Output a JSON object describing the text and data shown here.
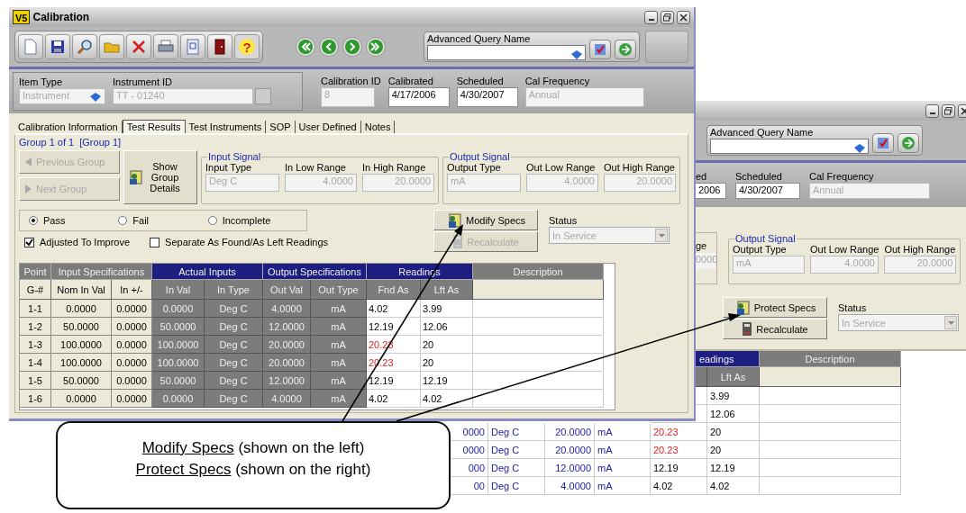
{
  "left_window": {
    "logo": "V5",
    "title": "Calibration",
    "help_glyph": "?",
    "query": {
      "label": "Advanced Query Name"
    },
    "header_fields": [
      {
        "kind": "combo",
        "label": "Item Type",
        "value": "Instrument",
        "disabled": true
      },
      {
        "kind": "lookup",
        "label": "Instrument ID",
        "value": "TT - 01240",
        "disabled": true
      },
      {
        "kind": "text",
        "label": "Calibration ID",
        "value": "8",
        "disabled": true
      },
      {
        "kind": "text",
        "label": "Calibrated",
        "value": "4/17/2006",
        "disabled": false
      },
      {
        "kind": "text",
        "label": "Scheduled",
        "value": "4/30/2007",
        "disabled": false
      },
      {
        "kind": "text",
        "label": "Cal Frequency",
        "value": "Annual",
        "disabled": true
      }
    ],
    "tabs": [
      {
        "label": "Calibration Information",
        "selected": false
      },
      {
        "label": "Test Results",
        "selected": true
      },
      {
        "label": "Test Instruments",
        "selected": false
      },
      {
        "label": "SOP",
        "selected": false
      },
      {
        "label": "User Defined",
        "selected": false
      },
      {
        "label": "Notes",
        "selected": false
      }
    ],
    "group_title": "Group 1 of 1  [Group 1]",
    "nav_buttons": [
      {
        "kind": "previous",
        "label": "Previous Group",
        "disabled": true
      },
      {
        "kind": "next",
        "label": "Next Group",
        "disabled": true
      }
    ],
    "details_button": {
      "label": "Show Group Details"
    },
    "signals": [
      {
        "title": "Input Signal",
        "fields": [
          {
            "kind": "type",
            "label": "Input Type",
            "value": "Deg C"
          },
          {
            "kind": "number",
            "label": "In Low Range",
            "value": "4.0000"
          },
          {
            "kind": "number",
            "label": "In High Range",
            "value": "20.0000"
          }
        ]
      },
      {
        "title": "Output Signal",
        "fields": [
          {
            "kind": "type",
            "label": "Output Type",
            "value": "mA"
          },
          {
            "kind": "number",
            "label": "Out Low Range",
            "value": "4.0000"
          },
          {
            "kind": "number",
            "label": "Out High Range",
            "value": "20.0000"
          }
        ]
      }
    ],
    "result_options": [
      {
        "label": "Pass",
        "selected": true
      },
      {
        "label": "Fail",
        "selected": false
      },
      {
        "label": "Incomplete",
        "selected": false
      }
    ],
    "checkboxes": [
      {
        "label": "Adjusted To Improve",
        "checked": true
      },
      {
        "label": "Separate As Found/As Left Readings",
        "checked": false
      }
    ],
    "spec_button": {
      "label": "Modify Specs",
      "disabled": false
    },
    "recalculate_button": {
      "label": "Recalculate",
      "disabled": true
    },
    "status": {
      "label": "Status",
      "value": "In Service",
      "disabled": true
    },
    "table": {
      "groups": [
        {
          "label": "Point",
          "kind": "spec",
          "columns": [
            "G-#"
          ]
        },
        {
          "label": "Input Specifications",
          "kind": "spec",
          "columns": [
            "Nom In Val",
            "In +/-"
          ]
        },
        {
          "label": "Actual Inputs",
          "kind": "actual",
          "columns": [
            "In Val",
            "In Type"
          ]
        },
        {
          "label": "Output Specifications",
          "kind": "actual",
          "columns": [
            "Out Val",
            "Out Type"
          ]
        },
        {
          "label": "Readings",
          "kind": "reading",
          "columns": [
            "Fnd As",
            "Lft As"
          ]
        },
        {
          "label": "Description",
          "kind": "description"
        }
      ],
      "rows": [
        {
          "cells": [
            "1-1",
            "0.0000",
            "0.0000",
            "0.0000",
            "Deg C",
            "4.0000",
            "mA",
            "4.02",
            "3.99"
          ],
          "alert": false
        },
        {
          "cells": [
            "1-2",
            "50.0000",
            "0.0000",
            "50.0000",
            "Deg C",
            "12.0000",
            "mA",
            "12.19",
            "12.06"
          ],
          "alert": false
        },
        {
          "cells": [
            "1-3",
            "100.0000",
            "0.0000",
            "100.0000",
            "Deg C",
            "20.0000",
            "mA",
            "20.23",
            "20"
          ],
          "alert": true
        },
        {
          "cells": [
            "1-4",
            "100.0000",
            "0.0000",
            "100.0000",
            "Deg C",
            "20.0000",
            "mA",
            "20.23",
            "20"
          ],
          "alert": true
        },
        {
          "cells": [
            "1-5",
            "50.0000",
            "0.0000",
            "50.0000",
            "Deg C",
            "12.0000",
            "mA",
            "12.19",
            "12.19"
          ],
          "alert": false
        },
        {
          "cells": [
            "1-6",
            "0.0000",
            "0.0000",
            "0.0000",
            "Deg C",
            "4.0000",
            "mA",
            "4.02",
            "4.02"
          ],
          "alert": false
        }
      ]
    }
  },
  "right_window": {
    "query": {
      "label": "Advanced Query Name"
    },
    "header_fields": [
      {
        "kind": "partial",
        "label": "ed",
        "value": "2006",
        "disabled": false
      },
      {
        "kind": "text",
        "label": "Scheduled",
        "value": "4/30/2007",
        "disabled": false
      },
      {
        "kind": "text",
        "label": "Cal Frequency",
        "value": "Annual",
        "disabled": true
      }
    ],
    "partial_field": {
      "label": "ge",
      "value": "0000"
    },
    "signal": {
      "title": "Output Signal",
      "fields": [
        {
          "kind": "type",
          "label": "Output Type",
          "value": "mA"
        },
        {
          "kind": "number",
          "label": "Out Low Range",
          "value": "4.0000"
        },
        {
          "kind": "number",
          "label": "Out High Range",
          "value": "20.0000"
        }
      ]
    },
    "spec_button": {
      "label": "Protect Specs",
      "disabled": false
    },
    "recalculate_button": {
      "label": "Recalculate",
      "disabled": false
    },
    "status": {
      "label": "Status",
      "value": "In Service",
      "disabled": true
    },
    "table": {
      "groups": [
        {
          "label": "eadings",
          "kind": "reading"
        },
        {
          "label": "Description",
          "kind": "description"
        }
      ],
      "columns": [
        "Lft As"
      ],
      "rows": [
        {
          "cells": [
            "3.99"
          ]
        },
        {
          "cells": [
            "12.06"
          ]
        },
        {
          "cells": [
            "0000",
            "Deg C",
            "20.0000",
            "mA",
            "20.23",
            "20"
          ],
          "alert": true
        },
        {
          "cells": [
            "0000",
            "Deg C",
            "20.0000",
            "mA",
            "20.23",
            "20"
          ],
          "alert": true
        },
        {
          "cells": [
            "000",
            "Deg C",
            "12.0000",
            "mA",
            "12.19",
            "12.19"
          ],
          "alert": false
        },
        {
          "cells": [
            "00",
            "Deg C",
            "4.0000",
            "mA",
            "4.02",
            "4.02"
          ],
          "alert": false
        }
      ]
    }
  },
  "callout": {
    "lines": [
      {
        "link": "Modify Specs",
        "text": "(shown on the left)"
      },
      {
        "link": "Protect Specs",
        "text": "(shown on the right)"
      }
    ]
  }
}
